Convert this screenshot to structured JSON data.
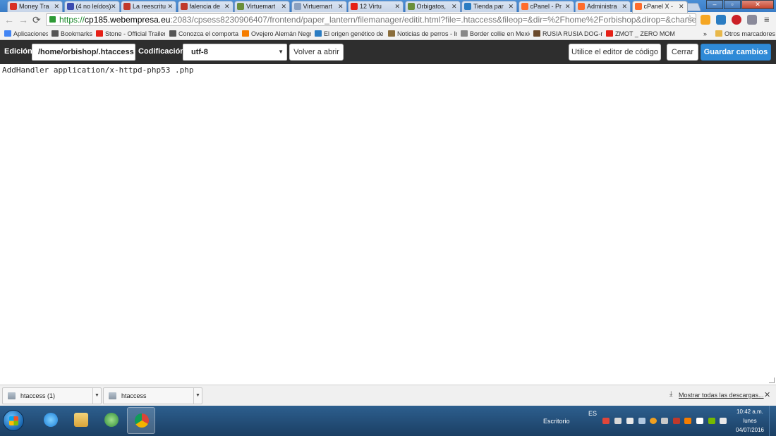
{
  "browser": {
    "tabs": [
      {
        "label": "Money Tra",
        "icon": "gmail-icon",
        "color": "#d93025"
      },
      {
        "label": "(4 no leídos)",
        "icon": "mail-icon",
        "color": "#3b4bb0"
      },
      {
        "label": "La reescritu",
        "icon": "w-icon",
        "color": "#c0392b"
      },
      {
        "label": "falencia de",
        "icon": "w-icon",
        "color": "#c0392b"
      },
      {
        "label": "Virtuemart",
        "icon": "virtuemart-icon",
        "color": "#6a8f3a"
      },
      {
        "label": "Virtuemart",
        "icon": "page-icon",
        "color": "#8aa0c0"
      },
      {
        "label": "12 Virtu",
        "icon": "youtube-icon",
        "color": "#e62117"
      },
      {
        "label": "Orbigatos,",
        "icon": "virtuemart-icon",
        "color": "#6a8f3a"
      },
      {
        "label": "Tienda par",
        "icon": "store-icon",
        "color": "#2a7cc2"
      },
      {
        "label": "cPanel - Pr",
        "icon": "cpanel-icon",
        "color": "#ff6c2c"
      },
      {
        "label": "Administra",
        "icon": "cpanel-icon",
        "color": "#ff6c2c"
      },
      {
        "label": "cPanel X -",
        "icon": "cpanel-icon",
        "color": "#ff6c2c"
      }
    ],
    "active_tab_index": 11,
    "url": {
      "protocol": "https://",
      "host": "cp185.webempresa.eu",
      "rest": ":2083/cpsess8230906407/frontend/paper_lantern/filemanager/editit.html?file=.htaccess&fileop=&dir=%2Fhome%2Forbishop&dirop=&charset=&file_cha"
    },
    "bookmarks": [
      {
        "label": "Aplicaciones",
        "icon": "apps-icon",
        "color": "#4285f4"
      },
      {
        "label": "Bookmarks",
        "icon": "star-icon",
        "color": "#555555"
      },
      {
        "label": "Stone - Official Trailer",
        "icon": "youtube-icon",
        "color": "#e62117"
      },
      {
        "label": "Conozca el comporta",
        "icon": "dog-icon",
        "color": "#555555"
      },
      {
        "label": "Ovejero Alemán Negr",
        "icon": "blogger-icon",
        "color": "#f57d00"
      },
      {
        "label": "El origen genético de",
        "icon": "s-icon",
        "color": "#2a7cc2"
      },
      {
        "label": "Noticias de perros - In",
        "icon": "dog-icon",
        "color": "#8a6d3b"
      },
      {
        "label": "Border collie en Mexic",
        "icon": "page-icon",
        "color": "#888888"
      },
      {
        "label": "RUSIA RUSIA DOG-ra",
        "icon": "dog-icon",
        "color": "#6b4a2b"
      },
      {
        "label": "ZMOT _ ZERO MOME",
        "icon": "youtube-icon",
        "color": "#e62117"
      }
    ],
    "bookmarks_overflow": "»",
    "other_bookmarks": "Otros marcadores"
  },
  "editbar": {
    "edition_label": "Edición:",
    "file_path": "/home/orbishop/.htaccess",
    "encoding_label": "Codificación:",
    "encoding_value": "utf-8",
    "reopen_label": "Volver a abrir",
    "code_editor_label": "Utilice el editor de código",
    "close_label": "Cerrar",
    "save_label": "Guardar cambios"
  },
  "editor": {
    "content": "AddHandler application/x-httpd-php53 .php"
  },
  "downloads": {
    "items": [
      {
        "name": "htaccess (1)"
      },
      {
        "name": "htaccess"
      }
    ],
    "show_all_label": "Mostrar todas las descargas..."
  },
  "taskbar": {
    "desktop_label": "Escritorio",
    "language": "ES",
    "clock": {
      "time": "10:42 a.m.",
      "day": "lunes",
      "date": "04/07/2016"
    }
  }
}
